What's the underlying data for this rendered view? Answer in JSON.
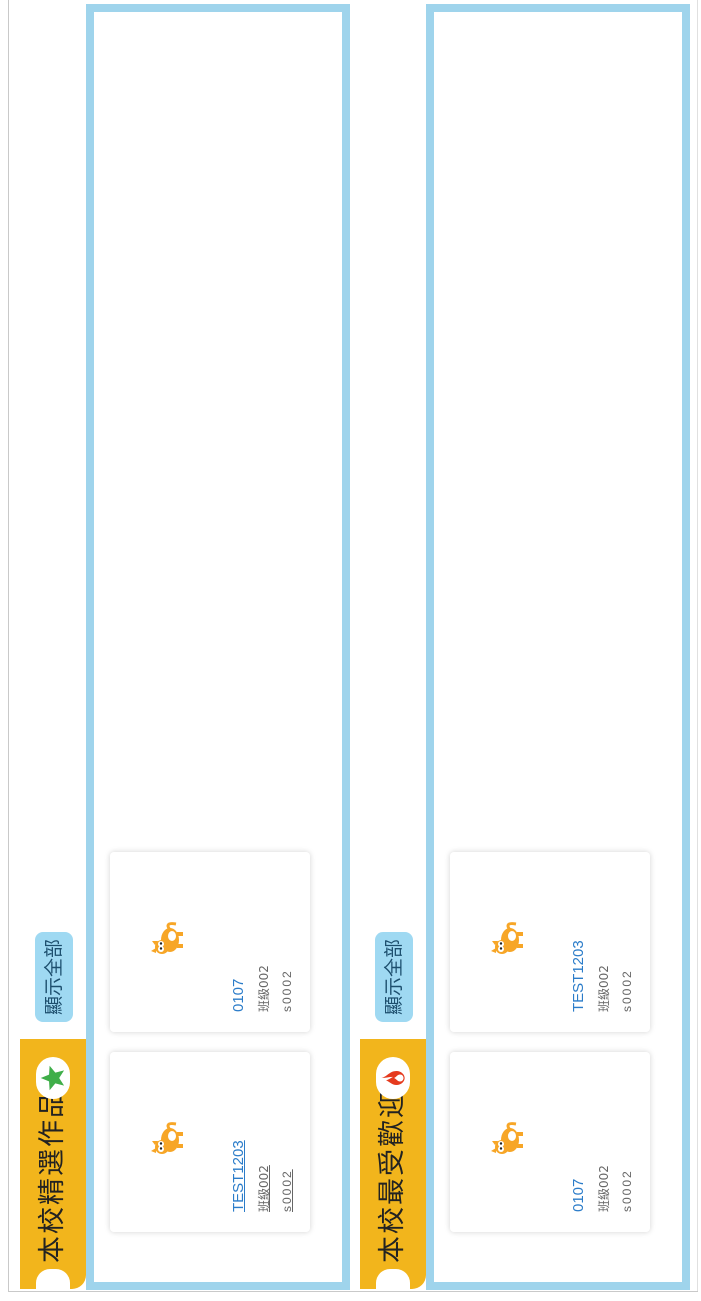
{
  "featured": {
    "title": "本校精選作品",
    "show_all": "顯示全部",
    "badge_icon": "star-icon",
    "cards": [
      {
        "title": "TEST1203",
        "class_name": "班級002",
        "user": "s0002"
      },
      {
        "title": "0107",
        "class_name": "班級002",
        "user": "s0002"
      }
    ]
  },
  "popular": {
    "title": "本校最受歡迎",
    "show_all": "顯示全部",
    "badge_icon": "flame-icon",
    "cards": [
      {
        "title": "0107",
        "class_name": "班級002",
        "user": "s0002"
      },
      {
        "title": "TEST1203",
        "class_name": "班級002",
        "user": "s0002"
      }
    ]
  },
  "colors": {
    "tab": "#f2b51c",
    "panel_border": "#9fd4ec",
    "button": "#9fd9f2",
    "link": "#2b7cc9",
    "star": "#3fae49",
    "flame": "#e53a1e"
  }
}
